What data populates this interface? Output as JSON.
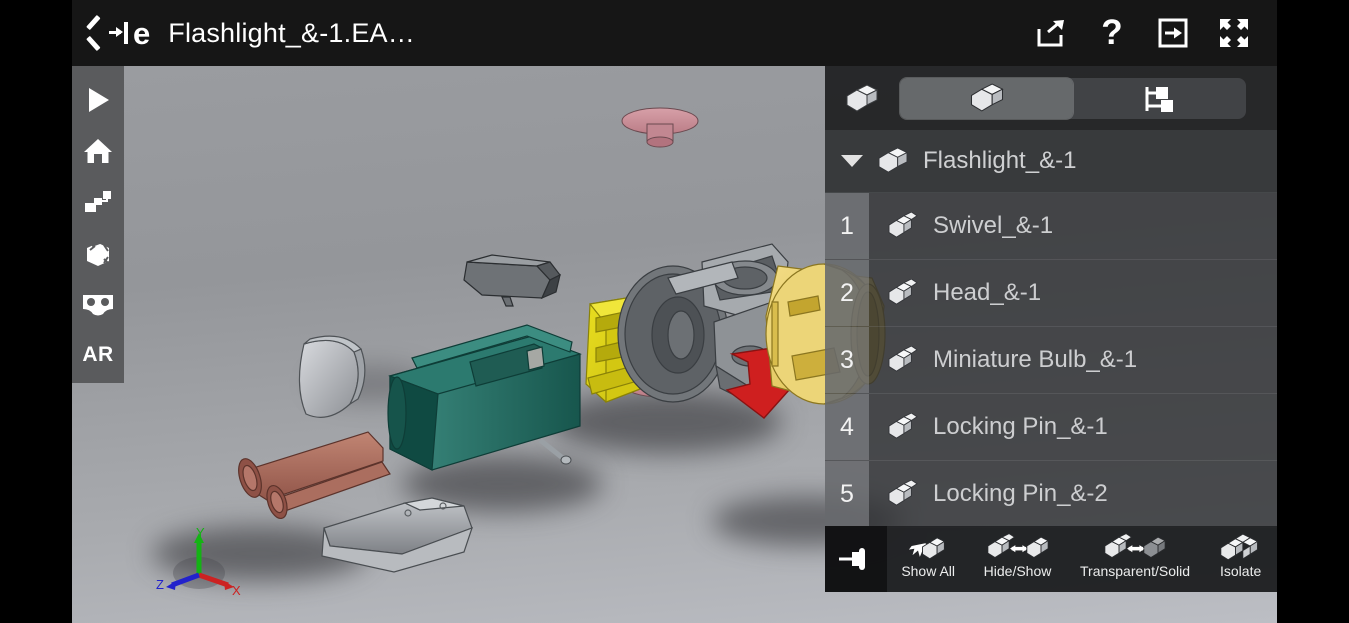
{
  "header": {
    "back_icon": "chevron-left-icon",
    "logo_text": "e",
    "title": "Flashlight_&-1.EA…",
    "actions": [
      {
        "name": "share-icon",
        "label": "Share"
      },
      {
        "name": "help-icon",
        "label": "?"
      },
      {
        "name": "exit-icon",
        "label": "Exit"
      },
      {
        "name": "fullscreen-icon",
        "label": "Fullscreen"
      }
    ]
  },
  "left_rail": {
    "items": [
      {
        "name": "play-button",
        "icon": "play-icon",
        "label": "Play"
      },
      {
        "name": "home-button",
        "icon": "home-icon",
        "label": "Home"
      },
      {
        "name": "explode-button",
        "icon": "explode-icon",
        "label": "Explode"
      },
      {
        "name": "section-button",
        "icon": "section-box-icon",
        "label": "Section"
      },
      {
        "name": "vr-button",
        "icon": "vr-goggles-icon",
        "label": "VR"
      },
      {
        "name": "ar-button",
        "icon": "ar-text-icon",
        "label": "AR"
      }
    ]
  },
  "viewport": {
    "axis_triad": {
      "x_label": "X",
      "y_label": "Y",
      "z_label": "Z",
      "x_color": "#cc2222",
      "y_color": "#14b314",
      "z_color": "#2222cc"
    },
    "background_color": "#949699"
  },
  "panel": {
    "header_icon": "assembly-cube-icon",
    "tabs": [
      {
        "name": "tab-components",
        "icon": "assembly-cube-icon",
        "selected": true
      },
      {
        "name": "tab-structure",
        "icon": "tree-hierarchy-icon",
        "selected": false
      }
    ],
    "root": {
      "label": "Flashlight_&-1",
      "expanded": true,
      "caret": "caret-down-icon",
      "icon": "assembly-cube-icon"
    },
    "items": [
      {
        "number": "1",
        "label": "Swivel_&-1",
        "icon": "part-cube-icon"
      },
      {
        "number": "2",
        "label": "Head_&-1",
        "icon": "part-cube-icon"
      },
      {
        "number": "3",
        "label": "Miniature Bulb_&-1",
        "icon": "part-cube-icon"
      },
      {
        "number": "4",
        "label": "Locking Pin_&-1",
        "icon": "part-cube-icon"
      },
      {
        "number": "5",
        "label": "Locking Pin_&-2",
        "icon": "part-cube-icon"
      }
    ],
    "bottom_tools": {
      "pin": {
        "name": "pin-button",
        "icon": "pin-icon"
      },
      "buttons": [
        {
          "name": "show-all-button",
          "label": "Show All",
          "icon": "show-all-icon"
        },
        {
          "name": "hide-show-button",
          "label": "Hide/Show",
          "icon": "hide-show-icon"
        },
        {
          "name": "transparent-solid-button",
          "label": "Transparent/Solid",
          "icon": "transparent-solid-icon"
        },
        {
          "name": "isolate-button",
          "label": "Isolate",
          "icon": "isolate-icon"
        }
      ]
    }
  },
  "colors": {
    "header_bg": "#161616",
    "panel_bg": "#2e3032",
    "rail_bg": "#5a5b5d",
    "accent_red": "#d02020",
    "part_teal": "#1d6258",
    "part_yellow": "#e0cc18",
    "part_gold": "#e8c94e",
    "part_pink": "#c98d96",
    "part_copper": "#a8685a"
  }
}
